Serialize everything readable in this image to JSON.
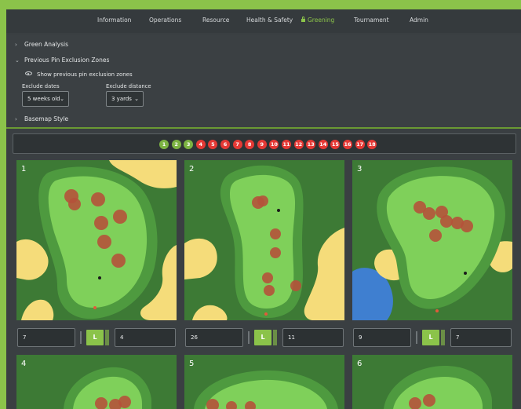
{
  "nav": {
    "items": [
      {
        "label": "Information",
        "active": false
      },
      {
        "label": "Operations",
        "active": false
      },
      {
        "label": "Resource",
        "active": false
      },
      {
        "label": "Health & Safety",
        "active": false
      },
      {
        "label": "Greening",
        "active": true
      },
      {
        "label": "Tournament",
        "active": false
      },
      {
        "label": "Admin",
        "active": false
      }
    ]
  },
  "sections": {
    "green_analysis": "Green Analysis",
    "previous_pin": "Previous Pin Exclusion Zones",
    "show_previous": "Show previous pin exclusion zones",
    "exclude_dates_label": "Exclude dates",
    "exclude_dates_value": "5 weeks old",
    "exclude_distance_label": "Exclude distance",
    "exclude_distance_value": "3 yards",
    "basemap_style": "Basemap Style"
  },
  "holes": [
    {
      "n": "1",
      "status": "green"
    },
    {
      "n": "2",
      "status": "green"
    },
    {
      "n": "3",
      "status": "green"
    },
    {
      "n": "4",
      "status": "red"
    },
    {
      "n": "5",
      "status": "red"
    },
    {
      "n": "6",
      "status": "red"
    },
    {
      "n": "7",
      "status": "red"
    },
    {
      "n": "8",
      "status": "red"
    },
    {
      "n": "9",
      "status": "red"
    },
    {
      "n": "10",
      "status": "red"
    },
    {
      "n": "11",
      "status": "red"
    },
    {
      "n": "12",
      "status": "red"
    },
    {
      "n": "13",
      "status": "red"
    },
    {
      "n": "14",
      "status": "red"
    },
    {
      "n": "15",
      "status": "red"
    },
    {
      "n": "16",
      "status": "red"
    },
    {
      "n": "17",
      "status": "red"
    },
    {
      "n": "18",
      "status": "red"
    }
  ],
  "cards": [
    {
      "number": "1",
      "left_value": "7",
      "toggle": "L",
      "right_value": "4"
    },
    {
      "number": "2",
      "left_value": "26",
      "toggle": "L",
      "right_value": "11"
    },
    {
      "number": "3",
      "left_value": "9",
      "toggle": "L",
      "right_value": "7"
    },
    {
      "number": "4"
    },
    {
      "number": "5"
    },
    {
      "number": "6"
    }
  ],
  "colors": {
    "accent": "#8bc34a",
    "hole_green": "#7cb342",
    "hole_red": "#e53935",
    "rough": "#3d7a35",
    "fringe": "#4e9a3f",
    "green": "#7fd05a",
    "bunker": "#f5dc7a",
    "water": "#3f7fd0",
    "exclusion": "#b5523a"
  },
  "icons": {
    "lock": "lock-icon",
    "eye": "eye-icon",
    "chevron_right": "chevron-right-icon",
    "chevron_down": "chevron-down-icon"
  }
}
